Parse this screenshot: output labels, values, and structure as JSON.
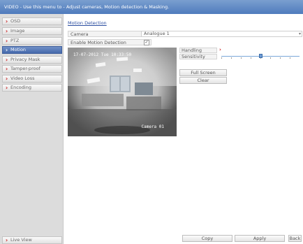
{
  "window": {
    "title": "VIDEO - Use this menu to - Adjust cameras, Motion detection & Masking."
  },
  "sidebar": {
    "items": [
      {
        "label": "OSD"
      },
      {
        "label": "Image"
      },
      {
        "label": "PTZ"
      },
      {
        "label": "Motion"
      },
      {
        "label": "Privacy Mask"
      },
      {
        "label": "Tamper-proof"
      },
      {
        "label": "Video Loss"
      },
      {
        "label": "Encoding"
      }
    ],
    "active_index": 3,
    "live_view_label": "Live View"
  },
  "main": {
    "section_title": "Motion Detection",
    "camera_label": "Camera",
    "camera_value": "Analogue 1",
    "enable_label": "Enable Motion Detection",
    "enable_checked": true,
    "enable_check_glyph": "✓",
    "video": {
      "timestamp": "17-07-2012 Tue 10:33:50",
      "camera_name": "Camera 01"
    },
    "handling_label": "Handling",
    "sensitivity_label": "Sensitivity",
    "sensitivity_level": 0.5,
    "full_screen_label": "Full Screen",
    "clear_label": "Clear"
  },
  "footer": {
    "copy_label": "Copy",
    "apply_label": "Apply",
    "back_label": "Back"
  },
  "colors": {
    "title_bar": "#5b82c0",
    "active_item": "#4f73b4",
    "chevron": "#c81c1c",
    "link": "#2b4ea0"
  },
  "icons": {
    "chevron": "chevron-right-icon",
    "dropdown": "chevron-down-icon"
  }
}
